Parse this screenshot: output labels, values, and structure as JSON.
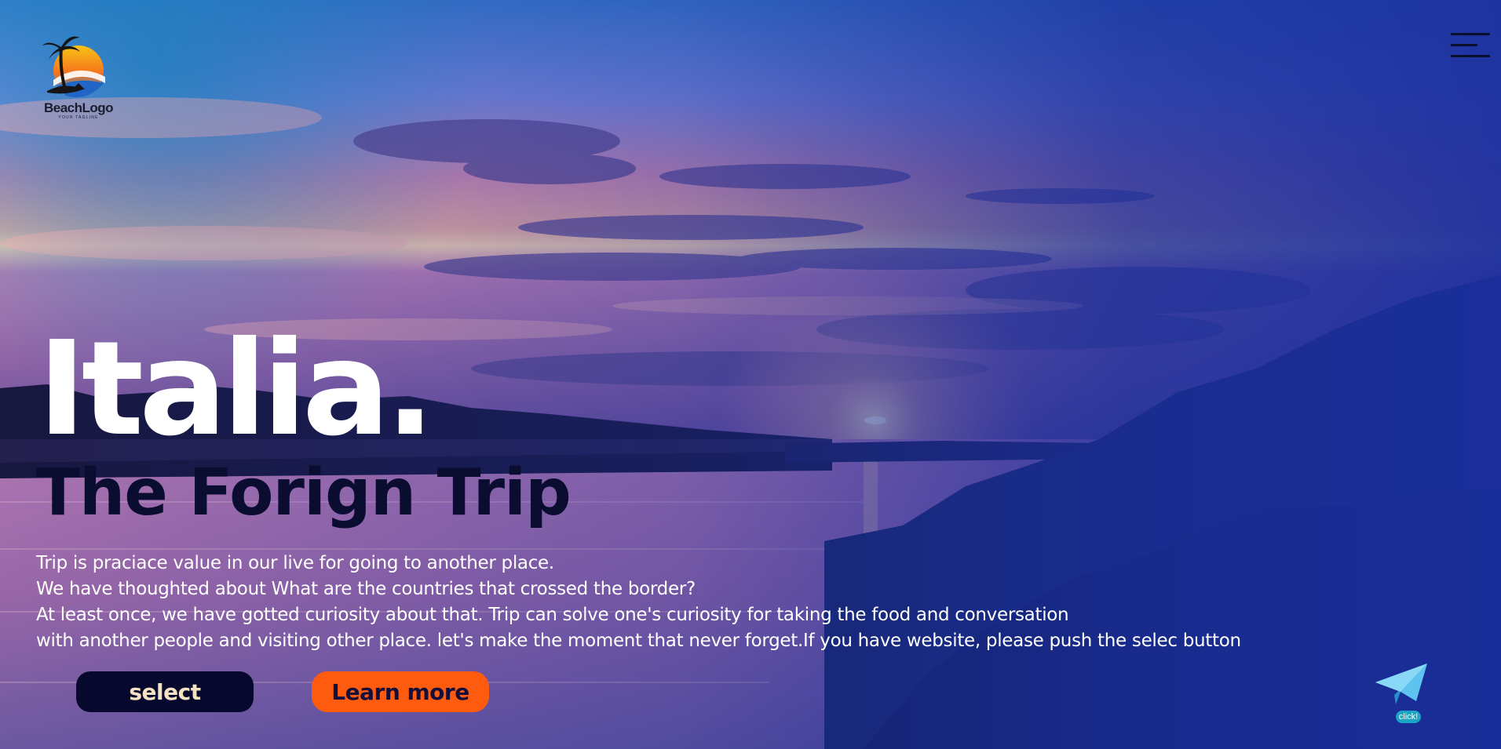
{
  "logo": {
    "name": "BeachLogo",
    "tagline": "YOUR TAGLINE"
  },
  "header": {
    "menu_icon": "hamburger-menu-icon"
  },
  "hero": {
    "title": "Italia.",
    "subtitle": "The Forign Trip",
    "body_lines": [
      "Trip is praciace value in our live for going to another place.",
      "We have thoughted about What are the countries that crossed the border?",
      "At least once, we have gotted curiosity about that. Trip can solve one's curiosity for taking the food and conversation",
      "with another people and visiting other place. let's make the moment that never forget.If you have website, please push the selec button"
    ],
    "buttons": {
      "select_label": "select",
      "learn_more_label": "Learn more"
    }
  },
  "send_widget": {
    "icon": "paper-plane-icon",
    "label": "click!"
  },
  "colors": {
    "title": "#ffffff",
    "subtitle": "#0a0d30",
    "select_button_bg": "#07082d",
    "select_button_text": "#f4e3c3",
    "learn_button_bg": "#ff5b0f",
    "learn_button_text": "#12103a",
    "overlay_blue": "#1a2f9c"
  }
}
